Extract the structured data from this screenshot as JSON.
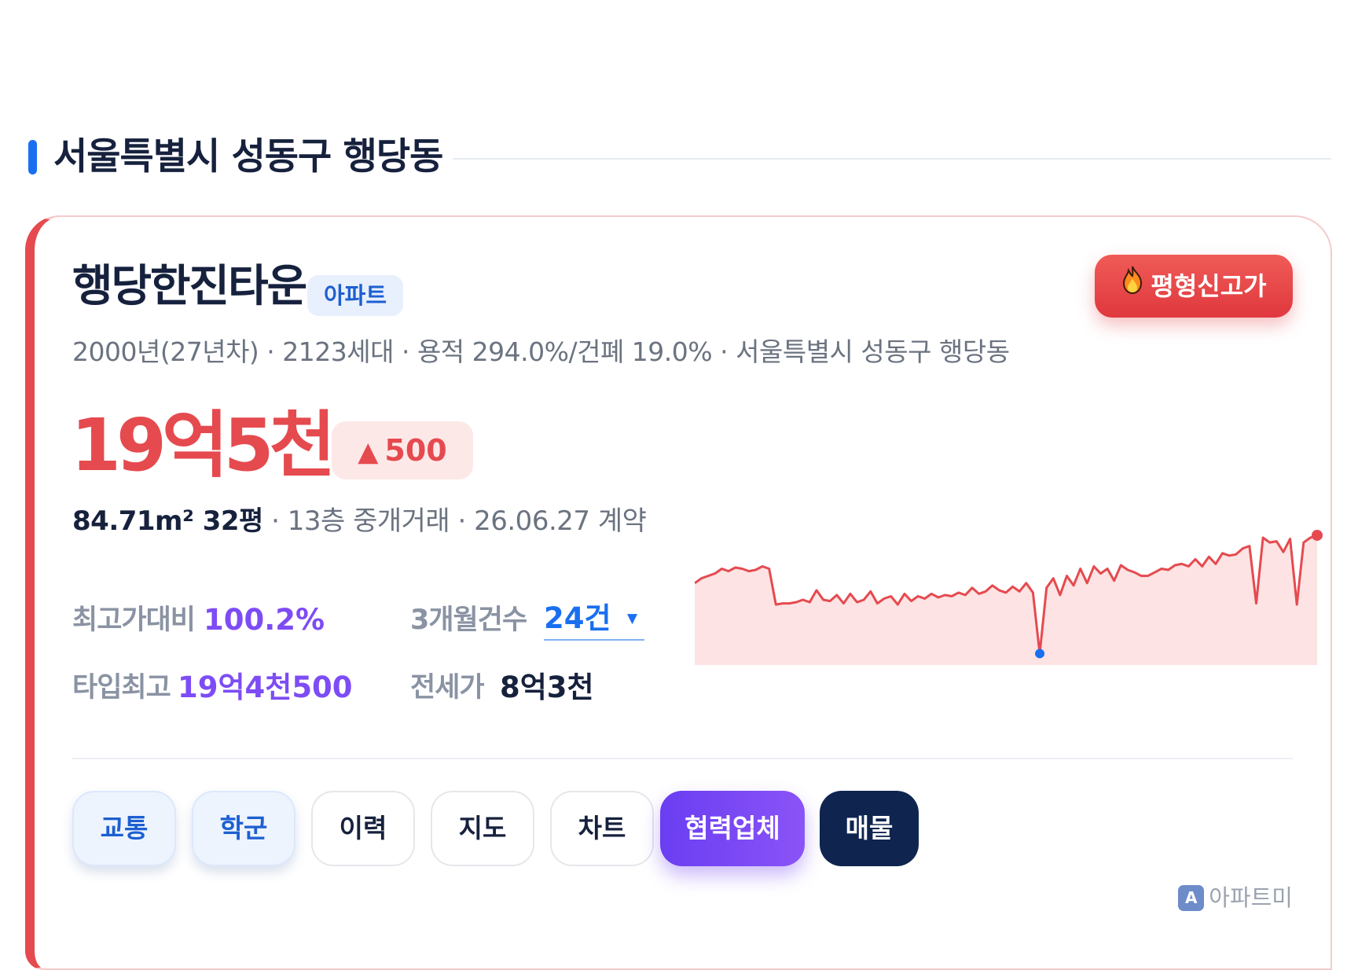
{
  "section": {
    "title": "서울특별시 성동구 행당동"
  },
  "card": {
    "name": "행당한진타운",
    "type_badge": "아파트",
    "record_badge": "평형신고가",
    "meta": "2000년(27년차) · 2123세대 · 용적 294.0%/건폐 19.0% · 서울특별시 성동구 행당동",
    "price": "19억5천",
    "change": "500",
    "area": "84.71m² 32평",
    "deal_detail": " · 13층 중개거래 · 26.06.27 계약",
    "stats": {
      "max_ratio_label": "최고가대비",
      "max_ratio_value": "100.2%",
      "count_label": "3개월건수",
      "count_value": "24건",
      "type_max_label": "타입최고",
      "type_max_value": "19억4천500",
      "jeonse_label": "전세가",
      "jeonse_value": "8억3천"
    },
    "buttons": {
      "traffic": "교통",
      "school": "학군",
      "history": "이력",
      "map": "지도",
      "chart": "차트",
      "partners": "협력업체",
      "listings": "매물"
    },
    "brand": {
      "logo_letter": "A",
      "name": "아파트미"
    }
  },
  "colors": {
    "accent_red": "#e54a4f",
    "accent_blue": "#1a6ff0",
    "accent_purple": "#7d4cf5",
    "navy": "#0f2550"
  },
  "icons": {
    "record_badge": "fire-icon",
    "change": "triangle-up-icon",
    "count_dropdown": "caret-down-icon",
    "brand": "apartme-logo-icon"
  },
  "chart_data": {
    "type": "area",
    "title": "",
    "xlabel": "",
    "ylabel": "",
    "ylim": [
      0,
      100
    ],
    "series": [
      {
        "values": [
          62,
          66,
          68,
          70,
          74,
          72,
          75,
          74,
          72,
          73,
          76,
          74,
          44,
          45,
          45,
          46,
          48,
          46,
          56,
          48,
          47,
          52,
          45,
          53,
          46,
          48,
          55,
          45,
          49,
          51,
          44,
          53,
          47,
          51,
          49,
          53,
          50,
          52,
          51,
          54,
          52,
          58,
          53,
          55,
          60,
          56,
          54,
          59,
          55,
          62,
          54,
          3,
          58,
          66,
          52,
          68,
          60,
          74,
          62,
          76,
          70,
          74,
          64,
          77,
          73,
          71,
          68,
          68,
          71,
          74,
          73,
          77,
          78,
          76,
          82,
          76,
          84,
          78,
          87,
          85,
          86,
          91,
          93,
          45,
          100,
          96,
          97,
          88,
          99,
          44,
          96,
          100,
          102
        ]
      }
    ],
    "min_point_index": 51,
    "max_point_index": 92
  }
}
